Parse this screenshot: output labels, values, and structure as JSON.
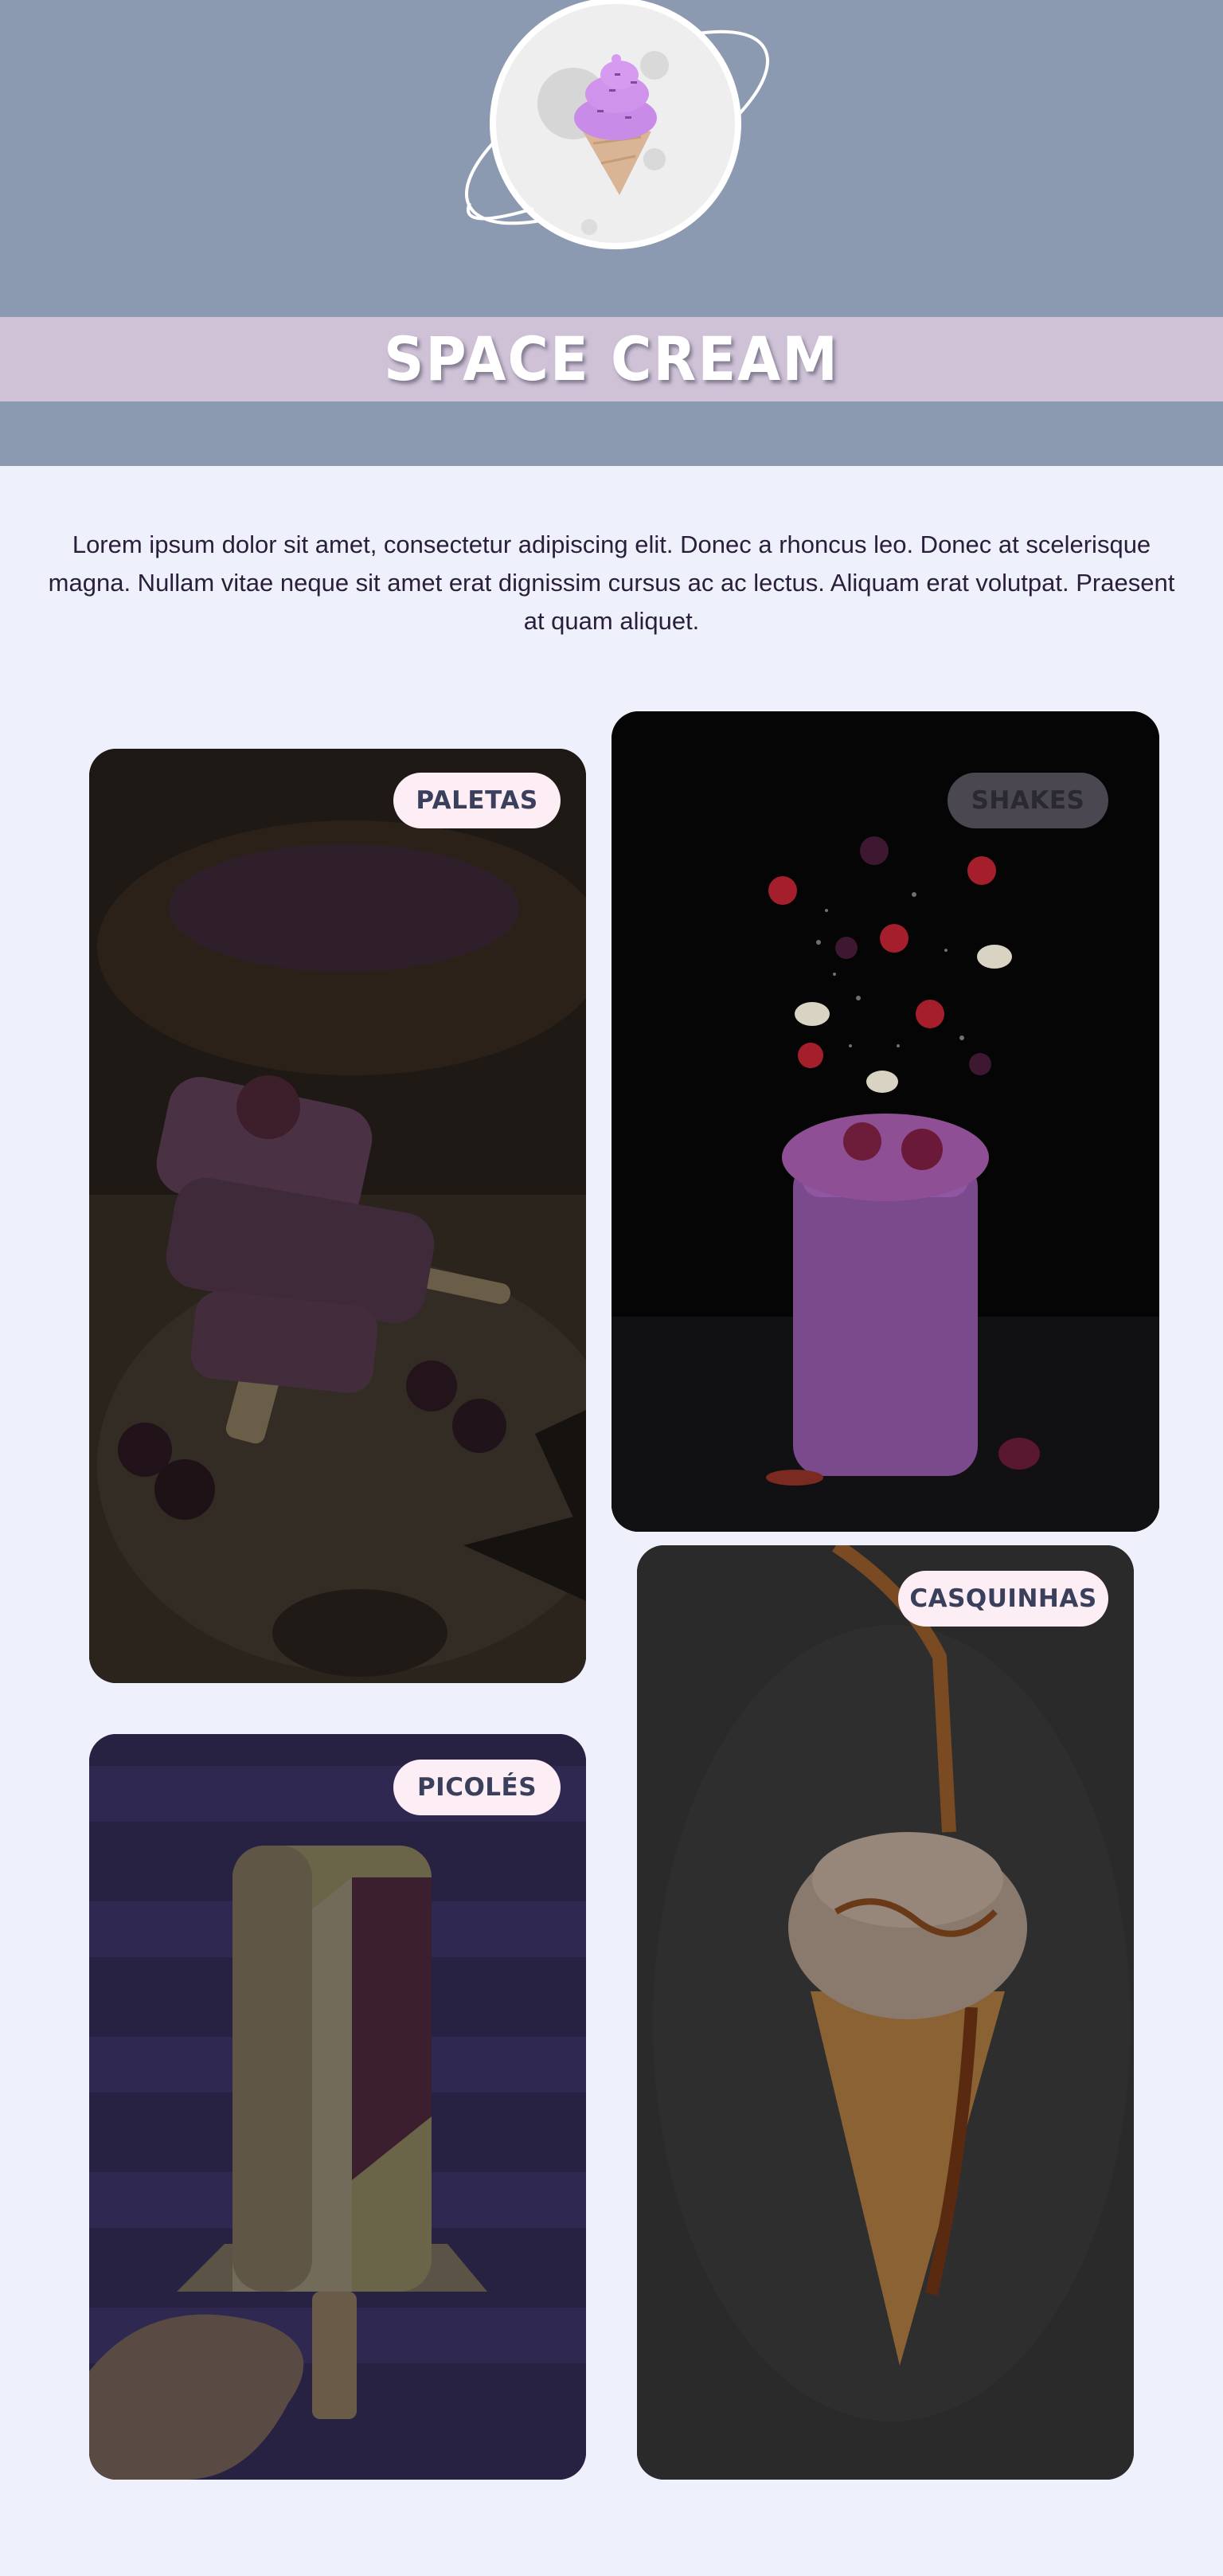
{
  "header": {
    "logo_icon": "planet-ice-cream-icon",
    "title": "SPACE CREAM"
  },
  "intro": {
    "text": "Lorem ipsum dolor sit amet, consectetur adipiscing elit. Donec a rhoncus leo. Donec at scelerisque magna. Nullam vitae neque sit amet erat dignissim cursus ac ac lectus. Aliquam erat volutpat. Praesent at quam aliquet."
  },
  "cards": [
    {
      "label": "PALETAS",
      "image": "stacked-popsicles-image"
    },
    {
      "label": "SHAKES",
      "image": "berry-shake-jar-image"
    },
    {
      "label": "CASQUINHAS",
      "image": "caramel-ice-cream-cone-image"
    },
    {
      "label": "PICOLÉS",
      "image": "nut-covered-ice-pop-image"
    }
  ],
  "colors": {
    "header_bg": "#8c9ab1",
    "title_band": "#cfc1d6",
    "page_bg": "#eef0fb",
    "badge_bg": "#fdeef6",
    "badge_text": "#3a3f5c"
  }
}
